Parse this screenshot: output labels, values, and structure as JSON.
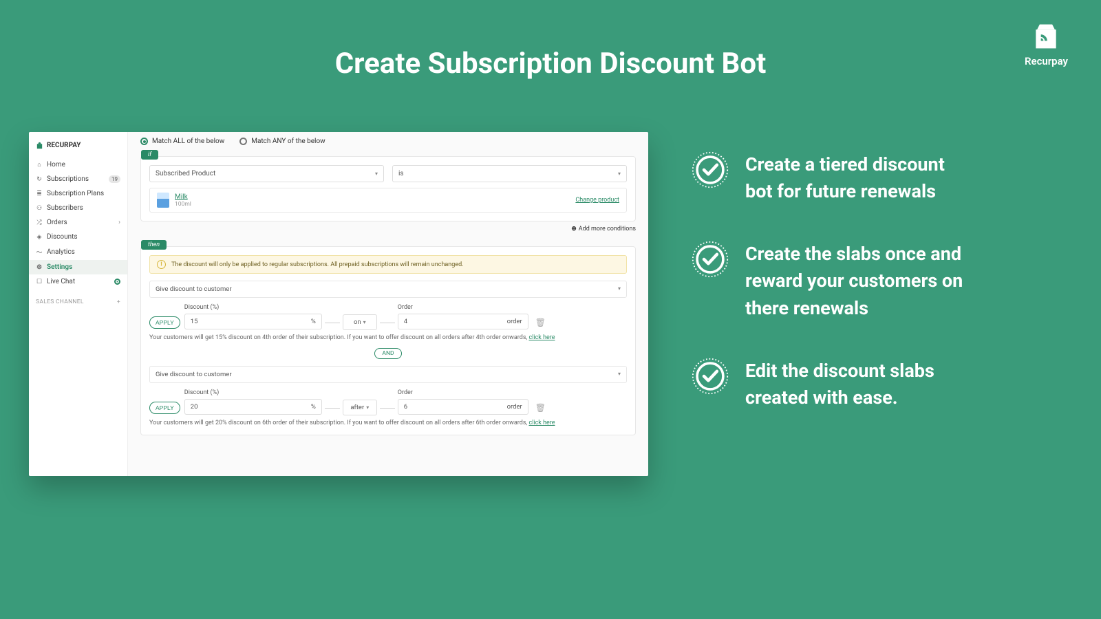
{
  "page_title": "Create Subscription Discount Bot",
  "brand": "Recurpay",
  "sidebar": {
    "brand": "RECURPAY",
    "items": [
      {
        "icon": "⌂",
        "label": "Home"
      },
      {
        "icon": "↻",
        "label": "Subscriptions",
        "badge": "19"
      },
      {
        "icon": "≣",
        "label": "Subscription Plans"
      },
      {
        "icon": "⚇",
        "label": "Subscribers"
      },
      {
        "icon": "⤮",
        "label": "Orders",
        "chevron": "›"
      },
      {
        "icon": "◈",
        "label": "Discounts"
      },
      {
        "icon": "〜",
        "label": "Analytics"
      },
      {
        "icon": "⚙",
        "label": "Settings",
        "active": true
      },
      {
        "icon": "☐",
        "label": "Live Chat",
        "dot": true
      }
    ],
    "sales_channel": "SALES CHANNEL"
  },
  "match": {
    "all": "Match ALL of the below",
    "any": "Match ANY of the below"
  },
  "if": {
    "tag": "if",
    "condition_field": "Subscribed Product",
    "operator": "is",
    "product_name": "Milk",
    "product_sub": "100ml",
    "change": "Change product",
    "add_more": "Add more conditions"
  },
  "then": {
    "tag": "then",
    "notice": "The discount will only be applied to regular subscriptions. All prepaid subscriptions will remain unchanged.",
    "give_label": "Give discount to customer",
    "discount_label": "Discount (%)",
    "order_label": "Order",
    "apply": "APPLY",
    "pct": "%",
    "order_suffix": "order",
    "and": "AND",
    "click_here": "click here",
    "slabs": [
      {
        "discount": "15",
        "when": "on",
        "order": "4",
        "helper": "Your customers will get 15% discount on 4th order of their subscription. If you want to offer discount on all orders after 4th order onwards, "
      },
      {
        "discount": "20",
        "when": "after",
        "order": "6",
        "helper": "Your customers will get 20% discount on 6th order of their subscription. If you want to offer discount on all orders after 6th order onwards, "
      }
    ]
  },
  "features": [
    "Create a tiered discount bot for future renewals",
    "Create the slabs once and reward your customers on there renewals",
    "Edit the discount slabs created with ease."
  ]
}
